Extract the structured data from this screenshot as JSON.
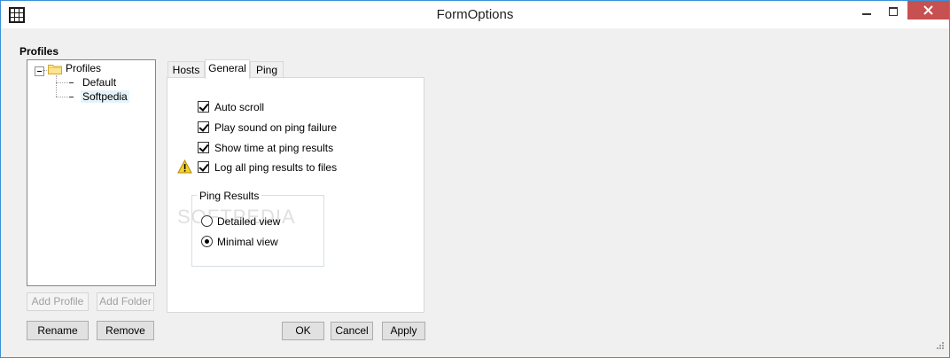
{
  "window": {
    "title": "FormOptions",
    "accent_color": "#3c8fd6",
    "close_color": "#c75050"
  },
  "profiles": {
    "heading": "Profiles",
    "tree": {
      "root": "Profiles",
      "children": [
        "Default",
        "Softpedia"
      ],
      "selected": "Softpedia"
    },
    "buttons": {
      "add_profile": "Add Profile",
      "add_folder": "Add Folder",
      "rename": "Rename",
      "remove": "Remove"
    }
  },
  "tabs": [
    {
      "label": "Hosts",
      "active": false
    },
    {
      "label": "General",
      "active": true
    },
    {
      "label": "Ping",
      "active": false
    }
  ],
  "general": {
    "checkboxes": [
      {
        "label": "Auto scroll",
        "checked": true
      },
      {
        "label": "Play sound on ping failure",
        "checked": true
      },
      {
        "label": "Show time at ping results",
        "checked": true
      },
      {
        "label": "Log all ping results to files",
        "checked": true,
        "icon": "warning-icon"
      }
    ],
    "ping_results": {
      "title": "Ping Results",
      "options": [
        {
          "label": "Detailed view",
          "selected": false
        },
        {
          "label": "Minimal view",
          "selected": true
        }
      ]
    },
    "watermark": "SOFTPEDIA"
  },
  "dialog_buttons": {
    "ok": "OK",
    "cancel": "Cancel",
    "apply": "Apply"
  }
}
